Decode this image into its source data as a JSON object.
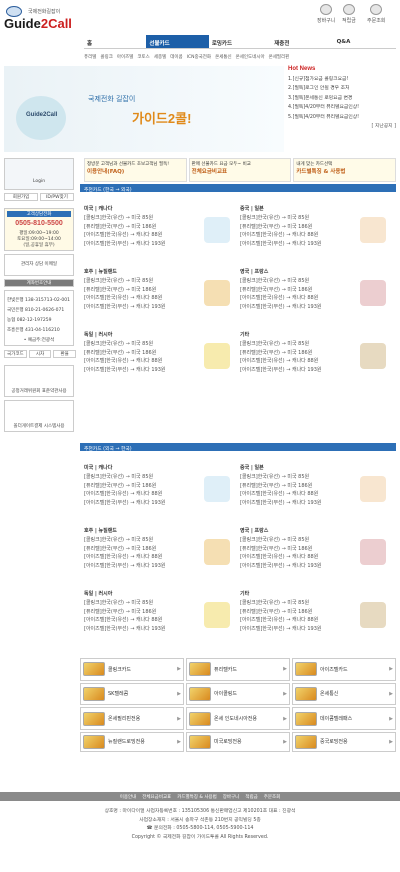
{
  "brand": {
    "name_a": "Guide",
    "name_b": "2Call",
    "tagline": "국제전화길잡이",
    "korea_label": "Korea Amerika"
  },
  "util": {
    "cart": "장바구니",
    "points": "적립금",
    "orders": "주문조회"
  },
  "nav1": [
    "홈",
    "선불카드",
    "로밍카드",
    "재충전",
    "Q&A"
  ],
  "nav2": [
    "퓨리텔",
    "콜링크",
    "아이즈텔",
    "코토스",
    "세종텔",
    "데이콤",
    "ICN중국전화",
    "온세통신",
    "온세인도네시아",
    "온세필리핀"
  ],
  "hero": {
    "line1": "국제전화 길잡이",
    "line2": "가이드2콜!",
    "disc": "Guide2Call"
  },
  "news": {
    "title": "Hot News",
    "items": [
      "1.[신규]첨가요금 콜링크요금!",
      "2.[필독]로그인 안될 경우 조처",
      "3.[필독]온세통신 로밍요금 변경",
      "4.[필독]4/20부터 퓨리텔요금인상!",
      "5.[필독]4/20부터 퓨리텔요금인상!"
    ],
    "more": "[ 지난공지 ]"
  },
  "banners": [
    {
      "small": "정방문 고객님과 선불카드 초보고객님 필독!",
      "big": "이용안내(FAQ)"
    },
    {
      "small": "판매 선불카드 요금 모두~ 비교",
      "big": "전체요금비교표"
    },
    {
      "small": "내게 맞는 카드선택",
      "big": "카드별특징 & 사용법"
    }
  ],
  "left": {
    "login": "Login",
    "find": "회원가입",
    "idpw": "ID/PW찾기",
    "center": "고객상담전화",
    "phone": "0505-810-5500",
    "hours1": "평일:09:00~19:00",
    "hours2": "토요일:09:00~14:00",
    "hours3": "(일,공휴일 휴무)",
    "mail": "관리자 상담 이메일",
    "bank": "계좌번호안내",
    "banks": [
      "한빛은행 138-315713-02-001",
      "국민은행 810-21-0626-071",
      "농협 082-12-197259",
      "조흥은행 431-04-116210"
    ],
    "holder": "• 예금주:전광석",
    "icons": [
      "국가코드",
      "시차",
      "환율"
    ],
    "ftc": "공정거래위원회 표준약관사용",
    "allthegate": "올더게이트결제 시스템사용"
  },
  "sect1": "추천카드 (한국 → 외국)",
  "sect2": "추천카드 (외국 → 한국)",
  "grid1": [
    {
      "hd": "미국 | 캐나다",
      "lines": [
        "[콜링크]한국(유선) → 미국 85원",
        "[퓨리텔]한국(무선) → 미국 186원",
        "[아이즈텔]한국(유선) → 캐나다 88원",
        "[아이즈텔]한국(무선) → 캐나다 193원"
      ]
    },
    {
      "hd": "중국 | 일본",
      "lines": [
        "[콜링크]한국(유선) → 미국 85원",
        "[퓨리텔]한국(무선) → 미국 186원",
        "[아이즈텔]한국(유선) → 캐나다 88원",
        "[아이즈텔]한국(무선) → 캐나다 193원"
      ]
    },
    {
      "hd": "호주 | 뉴질랜드",
      "lines": [
        "[콜링크]한국(유선) → 미국 85원",
        "[퓨리텔]한국(무선) → 미국 186원",
        "[아이즈텔]한국(유선) → 캐나다 88원",
        "[아이즈텔]한국(무선) → 캐나다 193원"
      ]
    },
    {
      "hd": "영국 | 프랑스",
      "lines": [
        "[콜링크]한국(유선) → 미국 85원",
        "[퓨리텔]한국(무선) → 미국 186원",
        "[아이즈텔]한국(유선) → 캐나다 88원",
        "[아이즈텔]한국(무선) → 캐나다 193원"
      ]
    },
    {
      "hd": "독일 | 러시아",
      "lines": [
        "[콜링크]한국(유선) → 미국 85원",
        "[퓨리텔]한국(무선) → 미국 186원",
        "[아이즈텔]한국(유선) → 캐나다 88원",
        "[아이즈텔]한국(무선) → 캐나다 193원"
      ]
    },
    {
      "hd": "기타",
      "lines": [
        "[콜링크]한국(유선) → 미국 85원",
        "[퓨리텔]한국(무선) → 미국 186원",
        "[아이즈텔]한국(유선) → 캐나다 88원",
        "[아이즈텔]한국(무선) → 캐나다 193원"
      ]
    }
  ],
  "cards": [
    [
      "콜링크카드",
      "퓨리텔카드",
      "아이즈텔카드"
    ],
    [
      "SK텔레콤",
      "아이콜링드",
      "온세통신"
    ],
    [
      "온세필리핀전용",
      "온세 인도네시아전용",
      "데이콤텔레패스"
    ],
    [
      "뉴질랜드로밍전용",
      "미국로밍전용",
      "중국로밍전용"
    ]
  ],
  "footnav": [
    "이용안내",
    "전체요금비교표",
    "카드별특징 & 사용법",
    "장바구니",
    "적립금",
    "주문조회"
  ],
  "footer": [
    "상호명 : 마이다이얼 사업자등록번호 : 135105306 통신판매업신고 제10201호 대표 : 진광석",
    "사업장소재지 : 서울시 송파구 석촌동 210번지 공익빌딩 5층",
    "☎ 문의전화 : 0505-5800-114, 0505-5900-114",
    "Copyright © 국제전화 길잡이 가이드투콜 All Rights Reserved."
  ]
}
